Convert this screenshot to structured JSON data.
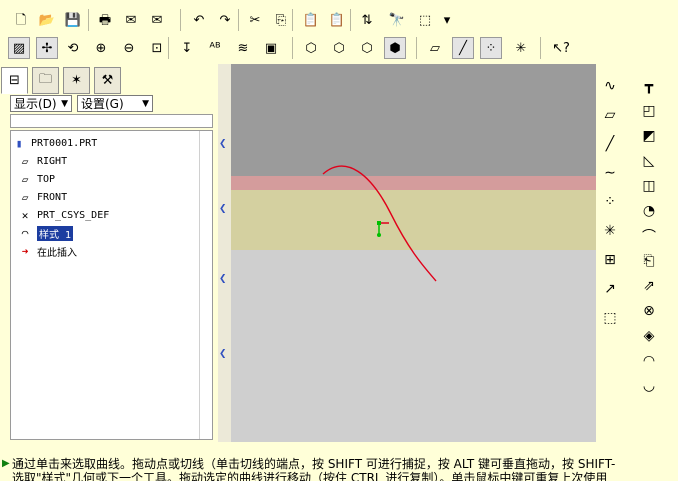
{
  "toolbar_top": {
    "items": [
      {
        "name": "new-icon",
        "glyph": "🗋"
      },
      {
        "name": "open-icon",
        "glyph": "📂"
      },
      {
        "name": "save-icon",
        "glyph": "💾"
      },
      {
        "name": "print-icon",
        "glyph": "🖶"
      },
      {
        "name": "email-icon",
        "glyph": "✉"
      },
      {
        "name": "email-attach-icon",
        "glyph": "✉"
      },
      {
        "name": "undo-icon",
        "glyph": "↶"
      },
      {
        "name": "redo-icon",
        "glyph": "↷"
      },
      {
        "name": "cut-icon",
        "glyph": "✂"
      },
      {
        "name": "copy-icon",
        "glyph": "⎘"
      },
      {
        "name": "paste-icon",
        "glyph": "📋"
      },
      {
        "name": "paste-special-icon",
        "glyph": "📋"
      },
      {
        "name": "regenerate-icon",
        "glyph": "⇅"
      },
      {
        "name": "find-icon",
        "glyph": "🔭"
      },
      {
        "name": "select-box-icon",
        "glyph": "⬚"
      },
      {
        "name": "select-dropdown-icon",
        "glyph": "▾"
      }
    ]
  },
  "toolbar_view": {
    "items": [
      {
        "name": "repaint-icon",
        "glyph": "▨",
        "pressed": true
      },
      {
        "name": "spin-center-icon",
        "glyph": "✢",
        "pressed": true
      },
      {
        "name": "orient-mode-icon",
        "glyph": "⟲"
      },
      {
        "name": "zoom-in-icon",
        "glyph": "⊕"
      },
      {
        "name": "zoom-out-icon",
        "glyph": "⊖"
      },
      {
        "name": "refit-icon",
        "glyph": "⊡"
      },
      {
        "name": "reorient-icon",
        "glyph": "↧"
      },
      {
        "name": "saved-views-icon",
        "glyph": "ᴬᴮ"
      },
      {
        "name": "layers-icon",
        "glyph": "≋"
      },
      {
        "name": "view-manager-icon",
        "glyph": "▣"
      },
      {
        "name": "wireframe-icon",
        "glyph": "⬡"
      },
      {
        "name": "hidden-line-icon",
        "glyph": "⬡"
      },
      {
        "name": "no-hidden-icon",
        "glyph": "⬡"
      },
      {
        "name": "shading-icon",
        "glyph": "⬢",
        "pressed": true
      },
      {
        "name": "datum-plane-display-icon",
        "glyph": "▱"
      },
      {
        "name": "datum-axis-display-icon",
        "glyph": "╱",
        "pressed": true
      },
      {
        "name": "datum-point-display-icon",
        "glyph": "⁘",
        "pressed": true
      },
      {
        "name": "csys-display-icon",
        "glyph": "✳"
      },
      {
        "name": "context-help-icon",
        "glyph": "↖?"
      }
    ]
  },
  "panel_tabs": [
    {
      "name": "tab-model-tree",
      "glyph": "⊟"
    },
    {
      "name": "tab-folder-browser",
      "glyph": "🗀"
    },
    {
      "name": "tab-favorites",
      "glyph": "✶"
    },
    {
      "name": "tab-connections",
      "glyph": "⚒"
    }
  ],
  "model_tree": {
    "show_label": "显示(D)",
    "settings_label": "设置(G)",
    "dropdown_arrow": "▼",
    "items": [
      {
        "name": "tree-item-root",
        "label": "PRT0001.PRT",
        "icon": "▮",
        "indent": 0
      },
      {
        "name": "tree-item-right",
        "label": "RIGHT",
        "icon": "▱",
        "indent": 1
      },
      {
        "name": "tree-item-top",
        "label": "TOP",
        "icon": "▱",
        "indent": 1
      },
      {
        "name": "tree-item-front",
        "label": "FRONT",
        "icon": "▱",
        "indent": 1
      },
      {
        "name": "tree-item-csys",
        "label": "PRT_CSYS_DEF",
        "icon": "✕",
        "indent": 1
      },
      {
        "name": "tree-item-style-1",
        "label": "样式 1",
        "icon": "◠",
        "indent": 1,
        "selected": true
      },
      {
        "name": "tree-item-insert-here",
        "label": "在此插入",
        "icon": "➜",
        "indent": 1
      }
    ]
  },
  "right_toolbar_1": [
    {
      "name": "sketch-curve-icon",
      "glyph": "∿"
    },
    {
      "name": "datum-plane-icon",
      "glyph": "▱"
    },
    {
      "name": "datum-axis-icon",
      "glyph": "╱"
    },
    {
      "name": "datum-curve-icon",
      "glyph": "∼"
    },
    {
      "name": "datum-point-icon",
      "glyph": "⁘"
    },
    {
      "name": "datum-csys-icon",
      "glyph": "✳"
    },
    {
      "name": "analysis-feature-icon",
      "glyph": "⊞"
    },
    {
      "name": "insert-annotation-icon",
      "glyph": "↗"
    },
    {
      "name": "trim-surface-icon",
      "glyph": "⬚"
    }
  ],
  "right_toolbar_2": [
    {
      "name": "shell-icon",
      "glyph": "┳"
    },
    {
      "name": "round-icon",
      "glyph": "◰"
    },
    {
      "name": "chamfer-icon",
      "glyph": "◩"
    },
    {
      "name": "draft-icon",
      "glyph": "◺"
    },
    {
      "name": "rib-icon",
      "glyph": "◫"
    },
    {
      "name": "revolve-icon",
      "glyph": "◔"
    },
    {
      "name": "sweep-icon",
      "glyph": "⌒"
    },
    {
      "name": "blend-icon",
      "glyph": "⎗"
    },
    {
      "name": "extend-icon",
      "glyph": "⇗"
    },
    {
      "name": "intersect-icon",
      "glyph": "⊗"
    },
    {
      "name": "merge-icon",
      "glyph": "◈"
    },
    {
      "name": "style-tool-icon",
      "glyph": "◠"
    },
    {
      "name": "boundary-blend-icon",
      "glyph": "◡"
    }
  ],
  "status": {
    "line1": "通过单击来选取曲线。拖动点或切线（单击切线的端点，按 SHIFT 可进行捕捉，按 ALT 键可垂直拖动，按 SHIFT-",
    "line2": "选取\"样式\"几何或下一个工具。拖动选定的曲线进行移动（按住 CTRL 进行复制）。单击鼠标中键可重复上次使用"
  },
  "colors": {
    "background": "#ffffd8",
    "curve": "#e0001a",
    "selection": "#1c3da0",
    "point": "#00c000"
  }
}
